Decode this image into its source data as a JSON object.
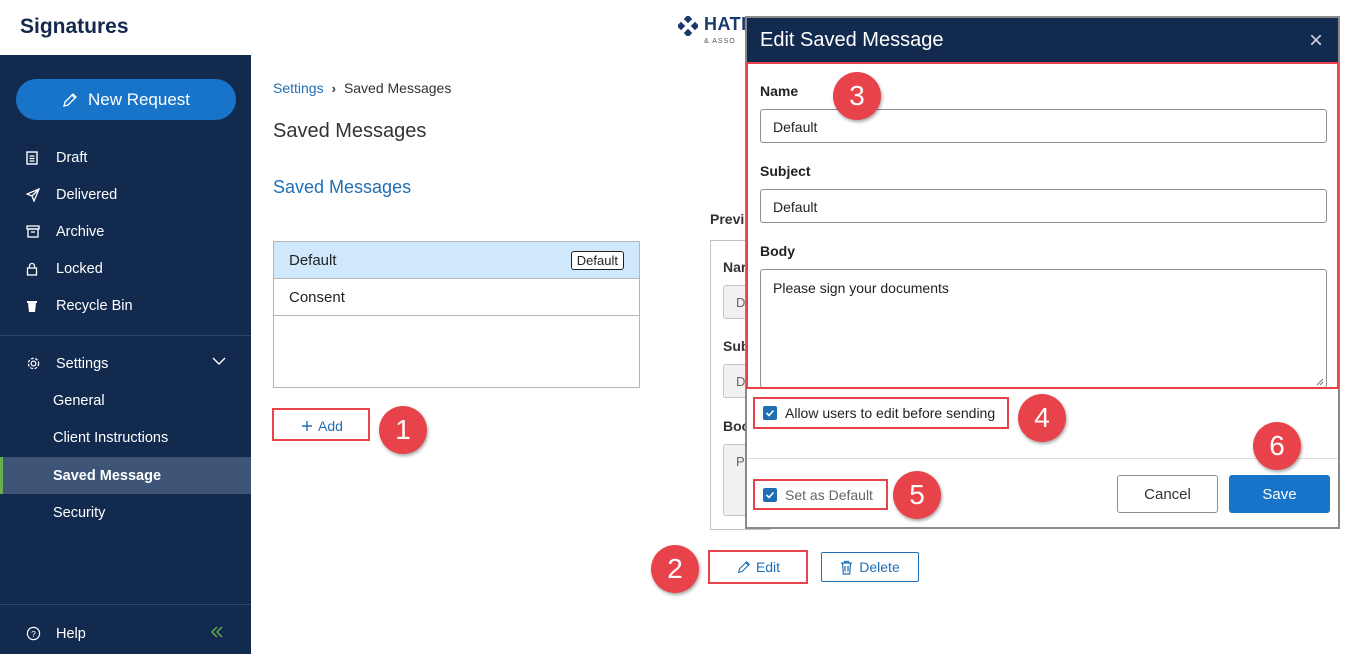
{
  "app": {
    "title": "Signatures"
  },
  "logo": {
    "text": "HATI",
    "sub": "& ASSO"
  },
  "sidebar": {
    "new_request": "New Request",
    "items": [
      {
        "label": "Draft",
        "icon": "document-icon"
      },
      {
        "label": "Delivered",
        "icon": "send-icon"
      },
      {
        "label": "Archive",
        "icon": "archive-icon"
      },
      {
        "label": "Locked",
        "icon": "lock-icon"
      },
      {
        "label": "Recycle Bin",
        "icon": "trash-icon"
      }
    ],
    "settings": {
      "label": "Settings",
      "subitems": [
        "General",
        "Client Instructions",
        "Saved Message",
        "Security"
      ],
      "active": "Saved Message"
    },
    "help": "Help"
  },
  "breadcrumb": {
    "parent": "Settings",
    "current": "Saved Messages"
  },
  "page_title": "Saved Messages",
  "section_title": "Saved Messages",
  "messages": {
    "items": [
      "Default",
      "Consent"
    ],
    "default_badge": "Default"
  },
  "add_label": "Add",
  "preview": {
    "label": "Previ",
    "name_label": "Nar",
    "name_value": "D",
    "subject_label": "Sub",
    "subject_value": "D",
    "body_label": "Boc",
    "body_value": "P"
  },
  "edit_label": "Edit",
  "delete_label": "Delete",
  "modal": {
    "title": "Edit Saved Message",
    "close": "×",
    "name_label": "Name",
    "name_value": "Default",
    "subject_label": "Subject",
    "subject_value": "Default",
    "body_label": "Body",
    "body_value": "Please sign your documents",
    "allow_edit_label": "Allow users to edit before sending",
    "set_default_label": "Set as Default",
    "cancel": "Cancel",
    "save": "Save"
  },
  "callouts": [
    "1",
    "2",
    "3",
    "4",
    "5",
    "6"
  ],
  "colors": {
    "sidebar": "#132a4f",
    "primary": "#1874c8",
    "link": "#1f6fb5",
    "highlight": "#e8434a",
    "selected_row": "#cfe8fb",
    "active_marker": "#6ab04c"
  }
}
